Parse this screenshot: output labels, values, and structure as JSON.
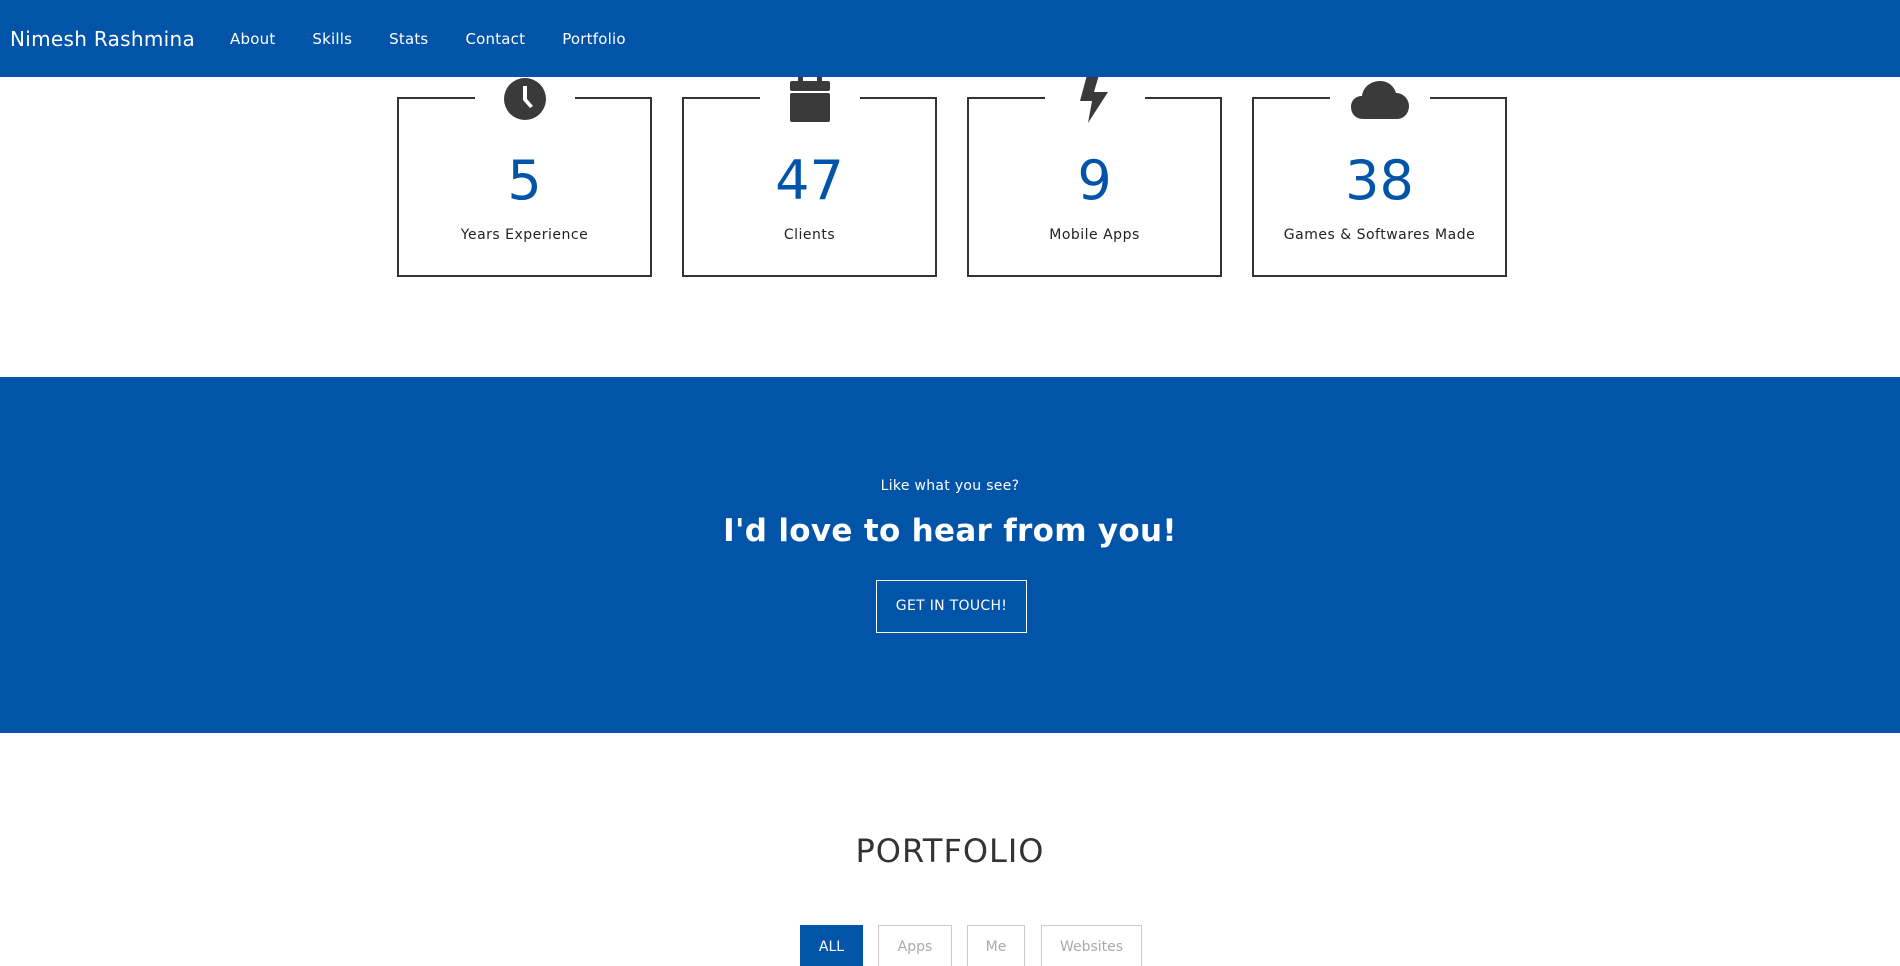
{
  "navbar": {
    "brand": "Nimesh Rashmina",
    "links": [
      {
        "label": "About"
      },
      {
        "label": "Skills"
      },
      {
        "label": "Stats"
      },
      {
        "label": "Contact"
      },
      {
        "label": "Portfolio"
      }
    ]
  },
  "stats": [
    {
      "icon": "clock-icon",
      "value": "5",
      "label": "Years Experience"
    },
    {
      "icon": "calendar-icon",
      "value": "47",
      "label": "Clients"
    },
    {
      "icon": "bolt-icon",
      "value": "9",
      "label": "Mobile Apps"
    },
    {
      "icon": "cloud-icon",
      "value": "38",
      "label": "Games & Softwares Made"
    }
  ],
  "cta": {
    "subtitle": "Like what you see?",
    "title": "I'd love to hear from you!",
    "button": "GET IN TOUCH!"
  },
  "portfolio": {
    "title": "PORTFOLIO",
    "filters": [
      {
        "label": "ALL",
        "active": true
      },
      {
        "label": "Apps",
        "active": false
      },
      {
        "label": "Me",
        "active": false
      },
      {
        "label": "Websites",
        "active": false
      }
    ]
  },
  "colors": {
    "primary": "#0254a8",
    "icon": "#3a3a3a",
    "border": "#333333"
  }
}
